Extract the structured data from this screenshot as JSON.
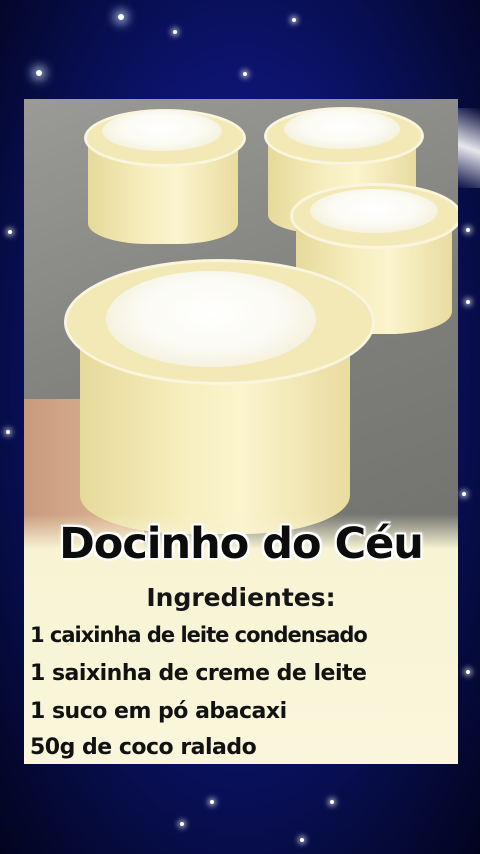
{
  "recipe": {
    "title": "Docinho do Céu",
    "subtitle": "Ingredientes:",
    "ingredients": [
      "1 caixinha de leite condensado",
      "1 saixinha de creme de leite",
      "1 suco em pó abacaxi",
      "50g de coco ralado"
    ]
  },
  "colors": {
    "background": "#0c1470",
    "cream": "#f7efc0",
    "text_panel": "#f7f3d3"
  }
}
